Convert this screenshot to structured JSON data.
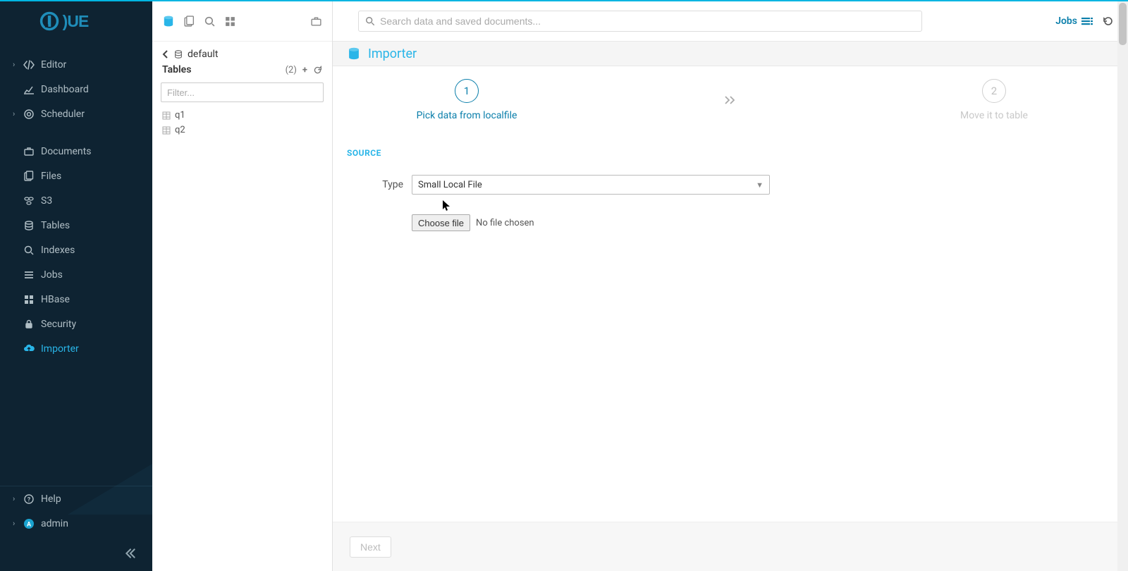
{
  "brand": {
    "name": "Hue"
  },
  "topbar": {
    "search_placeholder": "Search data and saved documents...",
    "jobs_label": "Jobs"
  },
  "sidebar": {
    "items": [
      {
        "label": "Editor",
        "icon": "code-icon",
        "expandable": true
      },
      {
        "label": "Dashboard",
        "icon": "chart-icon",
        "expandable": false
      },
      {
        "label": "Scheduler",
        "icon": "schedule-icon",
        "expandable": true
      }
    ],
    "apps": [
      {
        "label": "Documents",
        "icon": "briefcase-icon"
      },
      {
        "label": "Files",
        "icon": "folder-icon"
      },
      {
        "label": "S3",
        "icon": "s3-icon"
      },
      {
        "label": "Tables",
        "icon": "db-icon"
      },
      {
        "label": "Indexes",
        "icon": "search-plus-icon"
      },
      {
        "label": "Jobs",
        "icon": "list-icon"
      },
      {
        "label": "HBase",
        "icon": "grid-icon"
      },
      {
        "label": "Security",
        "icon": "lock-icon"
      },
      {
        "label": "Importer",
        "icon": "cloud-upload-icon",
        "active": true
      }
    ],
    "bottom": [
      {
        "label": "Help",
        "icon": "help-icon",
        "expandable": true
      },
      {
        "label": "admin",
        "icon": "avatar-icon",
        "expandable": true
      }
    ]
  },
  "assist": {
    "breadcrumb_db": "default",
    "tables_label": "Tables",
    "tables_count": "(2)",
    "filter_placeholder": "Filter...",
    "tables": [
      "q1",
      "q2"
    ]
  },
  "header": {
    "title": "Importer"
  },
  "wizard": {
    "step1_number": "1",
    "step1_label": "Pick data from localfile",
    "step2_number": "2",
    "step2_label": "Move it to table"
  },
  "form": {
    "section_title": "SOURCE",
    "type_label": "Type",
    "type_value": "Small Local File",
    "choose_file_label": "Choose file",
    "no_file_text": "No file chosen"
  },
  "footer": {
    "next_label": "Next"
  }
}
